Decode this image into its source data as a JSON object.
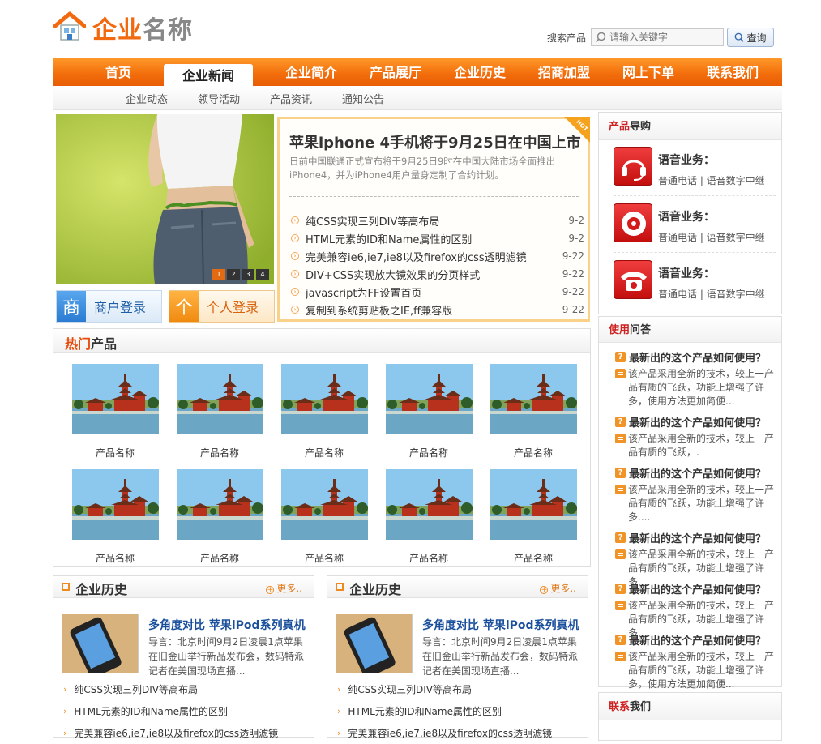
{
  "header": {
    "logo_text_a": "企业",
    "logo_text_b": "名称",
    "search_label": "搜索产品",
    "search_placeholder": "请输入关键字",
    "search_button": "查询"
  },
  "nav": {
    "items": [
      "首页",
      "企业新闻",
      "企业简介",
      "产品展厅",
      "企业历史",
      "招商加盟",
      "网上下单",
      "联系我们"
    ],
    "active_index": 1
  },
  "subnav": {
    "items": [
      "企业动态",
      "领导活动",
      "产品资讯",
      "通知公告"
    ]
  },
  "banner": {
    "pages": [
      "1",
      "2",
      "3",
      "4"
    ],
    "active_page": "1"
  },
  "login": {
    "merchant_icon": "商",
    "merchant_label": "商户登录",
    "personal_icon": "个",
    "personal_label": "个人登录"
  },
  "news": {
    "badge": "HOT",
    "headline": "苹果iphone 4手机将于9月25日在中国上市",
    "summary": "日前中国联通正式宣布将于9月25日9时在中国大陆市场全面推出iPhone4，并为iPhone4用户量身定制了合约计划。",
    "items": [
      {
        "title": "纯CSS实现三列DIV等高布局",
        "date": "9-2"
      },
      {
        "title": "HTML元素的ID和Name属性的区别",
        "date": "9-2"
      },
      {
        "title": "完美兼容ie6,ie7,ie8以及firefox的css透明滤镜",
        "date": "9-22"
      },
      {
        "title": "DIV+CSS实现放大镜效果的分页样式",
        "date": "9-22"
      },
      {
        "title": "javascript为FF设置首页",
        "date": "9-22"
      },
      {
        "title": "复制到系统剪贴板之IE,ff兼容版",
        "date": "9-22"
      }
    ]
  },
  "hot_products": {
    "title_highlight": "热门",
    "title_rest": "产品",
    "items": [
      "产品名称",
      "产品名称",
      "产品名称",
      "产品名称",
      "产品名称",
      "产品名称",
      "产品名称",
      "产品名称",
      "产品名称",
      "产品名称"
    ]
  },
  "history_panels": [
    {
      "title": "企业历史",
      "more": "更多..",
      "product_title": "多角度对比 苹果iPod系列真机",
      "product_desc": "导言：北京时间9月2日凌晨1点苹果在旧金山举行新品发布会，数码特派记者在美国现场直播...",
      "items": [
        "纯CSS实现三列DIV等高布局",
        "HTML元素的ID和Name属性的区别",
        "完美兼容ie6,ie7,ie8以及firefox的css透明滤镜"
      ]
    },
    {
      "title": "企业历史",
      "more": "更多..",
      "product_title": "多角度对比 苹果iPod系列真机",
      "product_desc": "导言：北京时间9月2日凌晨1点苹果在旧金山举行新品发布会，数码特派记者在美国现场直播...",
      "items": [
        "纯CSS实现三列DIV等高布局",
        "HTML元素的ID和Name属性的区别",
        "完美兼容ie6,ie7,ie8以及firefox的css透明滤镜"
      ]
    }
  ],
  "product_guide": {
    "title_highlight": "产品",
    "title_rest": "导购",
    "items": [
      {
        "title": "语音业务：",
        "sub": "普通电话 | 语音数字中继",
        "icon": "headset-icon"
      },
      {
        "title": "语音业务：",
        "sub": "普通电话 | 语音数字中继",
        "icon": "disc-icon"
      },
      {
        "title": "语音业务：",
        "sub": "普通电话 | 语音数字中继",
        "icon": "telephone-icon"
      }
    ]
  },
  "qa": {
    "title_highlight": "使用",
    "title_rest": "问答",
    "items": [
      {
        "q": "最新出的这个产品如何使用？",
        "a": "该产品采用全新的技术，较上一产品有质的飞跃，功能上增强了许多，使用方法更加简便..."
      },
      {
        "q": "最新出的这个产品如何使用？",
        "a": "该产品采用全新的技术，较上一产品有质的飞跃，."
      },
      {
        "q": "最新出的这个产品如何使用？",
        "a": "该产品采用全新的技术，较上一产品有质的飞跃，功能上增强了许多...."
      },
      {
        "q": "最新出的这个产品如何使用？",
        "a": "该产品采用全新的技术，较上一产品有质的飞跃，功能上增强了许多..."
      },
      {
        "q": "最新出的这个产品如何使用？",
        "a": "该产品采用全新的技术，较上一产品有质的飞跃，功能上增强了许多..."
      },
      {
        "q": "最新出的这个产品如何使用？",
        "a": "该产品采用全新的技术，较上一产品有质的飞跃，功能上增强了许多，使用方法更加简便..."
      }
    ]
  },
  "contact": {
    "title_highlight": "联系",
    "title_rest": "我们"
  },
  "colors": {
    "brand_orange": "#f26a10",
    "link_blue": "#1a4f9c",
    "accent_red": "#cf2020"
  }
}
